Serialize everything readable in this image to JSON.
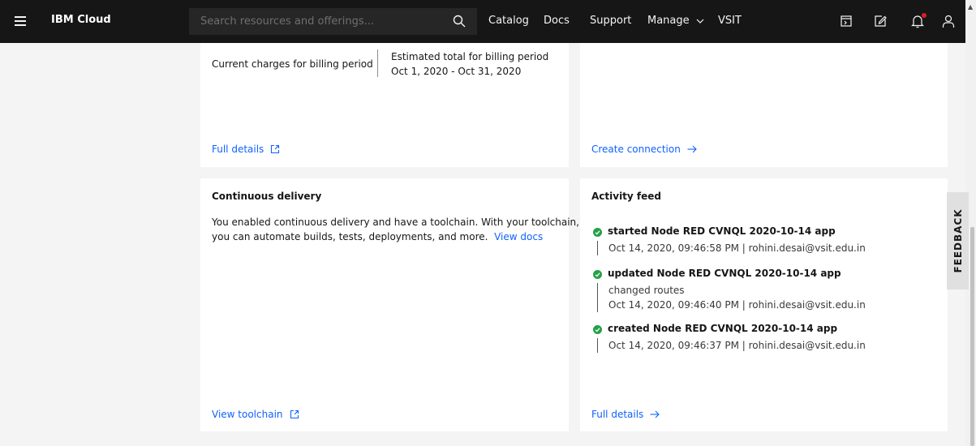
{
  "header": {
    "brand": "IBM Cloud",
    "search_placeholder": "Search resources and offerings...",
    "nav": {
      "catalog": "Catalog",
      "docs": "Docs",
      "support": "Support",
      "manage": "Manage",
      "account": "VSIT"
    },
    "icons": [
      "menu-icon",
      "search-icon",
      "chevron-down-icon",
      "cost-estimator-icon",
      "edit-icon",
      "notification-icon",
      "user-icon"
    ]
  },
  "billing_card": {
    "current_label": "Current charges for billing period",
    "estimated_label": "Estimated total for billing period",
    "period": "Oct 1, 2020 - Oct 31, 2020",
    "link": "Full details"
  },
  "connection_card": {
    "link": "Create connection"
  },
  "cd_card": {
    "title": "Continuous delivery",
    "description_line1": "You enabled continuous delivery and have a toolchain. With your toolchain,",
    "description_line2": "you can automate builds, tests, deployments, and more.",
    "docs_link": "View docs",
    "link": "View toolchain"
  },
  "activity_card": {
    "title": "Activity feed",
    "items": [
      {
        "title": "started Node RED CVNQL 2020-10-14 app",
        "detail": "Oct 14, 2020, 09:46:58 PM | rohini.desai@vsit.edu.in"
      },
      {
        "title": "updated Node RED CVNQL 2020-10-14 app",
        "change": "changed routes",
        "detail": "Oct 14, 2020, 09:46:40 PM | rohini.desai@vsit.edu.in"
      },
      {
        "title": "created Node RED CVNQL 2020-10-14 app",
        "detail": "Oct 14, 2020, 09:46:37 PM | rohini.desai@vsit.edu.in"
      }
    ],
    "link": "Full details"
  },
  "feedback": "FEEDBACK",
  "colors": {
    "header_bg": "#161616",
    "link": "#0f62fe",
    "success": "#24a148",
    "notification_dot": "#da1e28",
    "page_bg": "#f4f4f4"
  }
}
